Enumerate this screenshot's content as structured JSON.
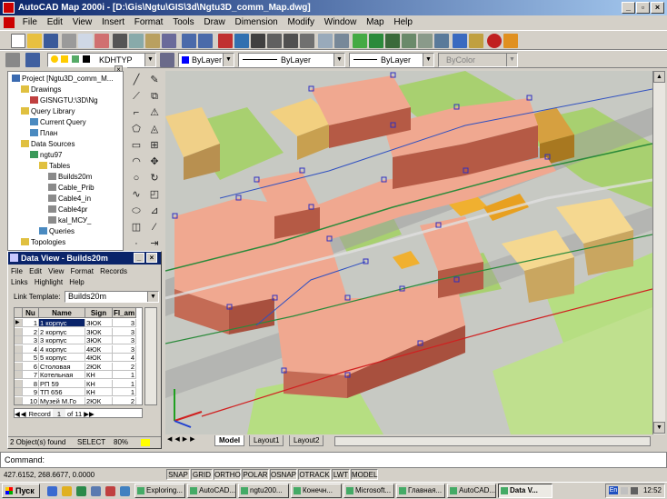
{
  "window": {
    "title": "AutoCAD Map 2000i - [D:\\Gis\\Ngtu\\GIS\\3d\\Ngtu3D_comm_Map.dwg]",
    "controls": [
      "_",
      "▫",
      "×"
    ]
  },
  "menu": [
    "File",
    "Edit",
    "View",
    "Insert",
    "Format",
    "Tools",
    "Draw",
    "Dimension",
    "Modify",
    "Window",
    "Map",
    "Help"
  ],
  "layer_toolbar": {
    "layer_name": "KDHTYP",
    "color_value": "ByLayer",
    "linetype_value": "ByLayer",
    "lineweight_value": "ByLayer",
    "plotstyle_value": "ByColor"
  },
  "tree": {
    "items": [
      {
        "label": "Project [Ngtu3D_comm_M...",
        "depth": 0,
        "icon": "project-icon"
      },
      {
        "label": "Drawings",
        "depth": 1,
        "icon": "folder-icon"
      },
      {
        "label": "GISNGTU:\\3D\\Ng",
        "depth": 2,
        "icon": "drawing-icon"
      },
      {
        "label": "Query Library",
        "depth": 1,
        "icon": "folder-icon"
      },
      {
        "label": "Current Query",
        "depth": 2,
        "icon": "query-icon"
      },
      {
        "label": "План",
        "depth": 2,
        "icon": "query-icon"
      },
      {
        "label": "Data Sources",
        "depth": 1,
        "icon": "folder-icon"
      },
      {
        "label": "ngtu97",
        "depth": 2,
        "icon": "database-icon"
      },
      {
        "label": "Tables",
        "depth": 3,
        "icon": "folder-icon"
      },
      {
        "label": "Builds20m",
        "depth": 4,
        "icon": "table-icon"
      },
      {
        "label": "Cable_Prib",
        "depth": 4,
        "icon": "table-icon"
      },
      {
        "label": "Cable4_in",
        "depth": 4,
        "icon": "table-icon"
      },
      {
        "label": "Cable4pr",
        "depth": 4,
        "icon": "table-icon"
      },
      {
        "label": "kal_МСУ_",
        "depth": 4,
        "icon": "table-icon"
      },
      {
        "label": "Queries",
        "depth": 3,
        "icon": "query-icon"
      },
      {
        "label": "Topologies",
        "depth": 1,
        "icon": "folder-icon"
      }
    ]
  },
  "dataview": {
    "title": "Data View - Builds20m",
    "menu": [
      "File",
      "Edit",
      "View",
      "Format",
      "Records"
    ],
    "menu2": [
      "Links",
      "Highlight",
      "Help"
    ],
    "link_template_label": "Link Template:",
    "link_template_value": "Builds20m",
    "columns": [
      "Nu",
      "Name",
      "Sign",
      "Fl_am"
    ],
    "rows": [
      [
        "1",
        "1 корпус",
        "ЗЮК",
        "3"
      ],
      [
        "2",
        "2 корпус",
        "ЗЮК",
        "3"
      ],
      [
        "3",
        "3 корпус",
        "ЗЮК",
        "3"
      ],
      [
        "4",
        "4 корпус",
        "4ЮК",
        "3"
      ],
      [
        "5",
        "5 корпус",
        "4ЮК",
        "4"
      ],
      [
        "6",
        "Столовая",
        "2ЮК",
        "2"
      ],
      [
        "7",
        "Котельная",
        "КН",
        "1"
      ],
      [
        "8",
        "РП 59",
        "КН",
        "1"
      ],
      [
        "9",
        "ТП 656",
        "КН",
        "1"
      ],
      [
        "10",
        "Музей М.Го",
        "2ЮК",
        "2"
      ]
    ],
    "record_label": "Record",
    "record_value": "1",
    "record_of": "of 11",
    "status_found": "2 Object(s) found",
    "status_mode": "SELECT",
    "status_zoom": "80%"
  },
  "layout_tabs": [
    "Model",
    "Layout1",
    "Layout2"
  ],
  "command": {
    "prompt": "Command:"
  },
  "status": {
    "coords": "427.6152, 268.6677, 0.0000",
    "toggles": [
      "SNAP",
      "GRID",
      "ORTHO",
      "POLAR",
      "OSNAP",
      "OTRACK",
      "LWT",
      "MODEL"
    ]
  },
  "taskbar": {
    "start_label": "Пуск",
    "tasks": [
      "Exploring...",
      "AutoCAD...",
      "ngtu200...",
      "Конечн...",
      "Microsoft...",
      "Главная...",
      "AutoCAD...",
      "Data V..."
    ],
    "active_index": 7,
    "clock": "12:52",
    "lang": "En"
  }
}
